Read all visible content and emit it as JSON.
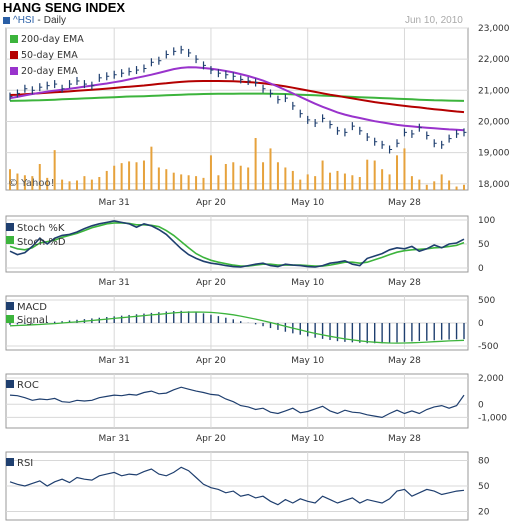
{
  "header": {
    "title": "HANG SENG INDEX",
    "symbol": "^HSI",
    "period": "Daily",
    "date": "Jun 10, 2010",
    "watermark": "© Yahoo!"
  },
  "colors": {
    "ema200": "#3cb43c",
    "ema50": "#b40000",
    "ema20": "#9933cc",
    "price": "#1f3f6f",
    "volume": "#e6a23c",
    "stochK": "#1f3f6f",
    "stochD": "#3cb43c",
    "macd": "#1f3f6f",
    "signal": "#3cb43c",
    "line": "#1f3f6f",
    "grid": "#d8d8d8"
  },
  "chart_data": [
    {
      "type": "line",
      "panel": "price",
      "ylim": [
        17800,
        23000
      ],
      "yticks": [
        "23,000",
        "22,000",
        "21,000",
        "20,000",
        "19,000",
        "18,000"
      ],
      "ytick_values": [
        23000,
        22000,
        21000,
        20000,
        19000,
        18000
      ],
      "xticks": [
        "Mar 31",
        "Apr 20",
        "May 10",
        "May 28"
      ],
      "xtick_index": [
        14,
        27,
        40,
        53
      ],
      "legend": [
        "200-day EMA",
        "50-day EMA",
        "20-day EMA"
      ],
      "price": [
        20800,
        20900,
        21050,
        21000,
        21100,
        21150,
        21200,
        21050,
        21200,
        21300,
        21200,
        21150,
        21400,
        21450,
        21500,
        21550,
        21600,
        21650,
        21700,
        21900,
        21950,
        22150,
        22250,
        22300,
        22200,
        22000,
        21800,
        21650,
        21550,
        21500,
        21450,
        21350,
        21300,
        21250,
        21050,
        20900,
        20700,
        20750,
        20500,
        20250,
        20050,
        19950,
        20100,
        19900,
        19700,
        19650,
        19850,
        19700,
        19500,
        19350,
        19250,
        19100,
        19300,
        19650,
        19600,
        19800,
        19550,
        19300,
        19250,
        19450,
        19600,
        19650
      ],
      "ema200": [
        20660,
        20665,
        20670,
        20675,
        20680,
        20690,
        20700,
        20710,
        20720,
        20730,
        20740,
        20750,
        20760,
        20770,
        20780,
        20790,
        20800,
        20805,
        20810,
        20820,
        20830,
        20840,
        20850,
        20860,
        20870,
        20875,
        20880,
        20885,
        20888,
        20890,
        20892,
        20893,
        20894,
        20894,
        20893,
        20890,
        20885,
        20880,
        20870,
        20860,
        20850,
        20840,
        20830,
        20820,
        20810,
        20800,
        20790,
        20780,
        20770,
        20760,
        20750,
        20740,
        20730,
        20720,
        20710,
        20700,
        20690,
        20680,
        20675,
        20670,
        20665,
        20660
      ],
      "ema50": [
        20850,
        20860,
        20875,
        20890,
        20905,
        20920,
        20935,
        20950,
        20965,
        20985,
        21000,
        21015,
        21035,
        21055,
        21075,
        21095,
        21115,
        21135,
        21155,
        21180,
        21205,
        21225,
        21250,
        21270,
        21285,
        21295,
        21300,
        21300,
        21298,
        21295,
        21290,
        21280,
        21265,
        21248,
        21225,
        21195,
        21160,
        21125,
        21085,
        21040,
        20995,
        20950,
        20905,
        20860,
        20820,
        20780,
        20740,
        20700,
        20660,
        20620,
        20590,
        20560,
        20530,
        20500,
        20475,
        20450,
        20420,
        20395,
        20370,
        20345,
        20320,
        20300
      ],
      "ema20": [
        20750,
        20790,
        20835,
        20880,
        20920,
        20960,
        20990,
        21020,
        21050,
        21085,
        21120,
        21150,
        21185,
        21220,
        21260,
        21300,
        21350,
        21400,
        21450,
        21500,
        21560,
        21620,
        21680,
        21720,
        21740,
        21735,
        21715,
        21690,
        21660,
        21620,
        21575,
        21520,
        21460,
        21390,
        21310,
        21220,
        21120,
        21010,
        20900,
        20790,
        20680,
        20570,
        20470,
        20380,
        20290,
        20220,
        20160,
        20110,
        20060,
        20010,
        19970,
        19930,
        19890,
        19860,
        19840,
        19820,
        19800,
        19780,
        19760,
        19745,
        19735,
        19720
      ]
    },
    {
      "type": "bar",
      "panel": "volume",
      "values": [
        120,
        95,
        85,
        80,
        150,
        70,
        230,
        60,
        50,
        55,
        80,
        60,
        75,
        110,
        140,
        155,
        165,
        160,
        170,
        250,
        130,
        120,
        100,
        90,
        85,
        80,
        70,
        200,
        85,
        150,
        160,
        140,
        130,
        300,
        160,
        240,
        160,
        130,
        110,
        60,
        90,
        80,
        170,
        100,
        110,
        95,
        85,
        75,
        175,
        170,
        120,
        90,
        200,
        240,
        80,
        60,
        30,
        50,
        90,
        55,
        20,
        30
      ]
    },
    {
      "type": "line",
      "panel": "stochastic",
      "ylim": [
        0,
        100
      ],
      "yticks": [
        "100",
        "50",
        "0"
      ],
      "ytick_values": [
        100,
        50,
        0
      ],
      "legend": [
        "Stoch %K",
        "Stoch %D"
      ],
      "k": [
        35,
        28,
        32,
        45,
        62,
        50,
        62,
        68,
        70,
        75,
        82,
        88,
        92,
        95,
        98,
        95,
        92,
        85,
        92,
        88,
        80,
        70,
        55,
        40,
        28,
        20,
        14,
        10,
        8,
        5,
        3,
        2,
        5,
        8,
        10,
        5,
        3,
        8,
        6,
        5,
        3,
        2,
        5,
        10,
        12,
        15,
        8,
        5,
        20,
        25,
        30,
        38,
        42,
        40,
        45,
        35,
        40,
        48,
        42,
        50,
        52,
        60
      ],
      "d": [
        45,
        40,
        38,
        42,
        52,
        55,
        58,
        64,
        68,
        72,
        78,
        84,
        88,
        92,
        94,
        94,
        93,
        90,
        90,
        89,
        86,
        78,
        68,
        55,
        42,
        30,
        22,
        16,
        12,
        9,
        6,
        4,
        4,
        6,
        8,
        8,
        6,
        6,
        6,
        6,
        5,
        4,
        4,
        6,
        9,
        12,
        12,
        10,
        12,
        17,
        22,
        28,
        33,
        36,
        38,
        39,
        40,
        42,
        43,
        45,
        47,
        53
      ]
    },
    {
      "type": "bar",
      "panel": "macd",
      "ylim": [
        -500,
        500
      ],
      "yticks": [
        "500",
        "0",
        "-500"
      ],
      "ytick_values": [
        500,
        0,
        -500
      ],
      "legend": [
        "MACD",
        "Signal"
      ],
      "macd": [
        -40,
        -30,
        -20,
        -10,
        5,
        20,
        30,
        40,
        55,
        70,
        85,
        100,
        115,
        130,
        145,
        160,
        175,
        190,
        205,
        220,
        235,
        250,
        260,
        265,
        255,
        235,
        210,
        180,
        150,
        115,
        80,
        40,
        5,
        -30,
        -70,
        -110,
        -150,
        -190,
        -225,
        -255,
        -290,
        -320,
        -345,
        -370,
        -395,
        -410,
        -420,
        -430,
        -440,
        -440,
        -440,
        -430,
        -420,
        -410,
        -400,
        -390,
        -385,
        -375,
        -365,
        -360,
        -355,
        -350
      ],
      "signal": [
        -60,
        -55,
        -48,
        -40,
        -32,
        -22,
        -12,
        0,
        12,
        25,
        40,
        55,
        70,
        85,
        100,
        115,
        130,
        145,
        160,
        175,
        190,
        205,
        220,
        230,
        237,
        240,
        238,
        230,
        218,
        200,
        178,
        150,
        118,
        85,
        48,
        10,
        -30,
        -70,
        -110,
        -150,
        -190,
        -225,
        -258,
        -290,
        -318,
        -345,
        -368,
        -388,
        -405,
        -418,
        -428,
        -434,
        -436,
        -435,
        -430,
        -423,
        -415,
        -406,
        -398,
        -390,
        -382,
        -375
      ]
    },
    {
      "type": "line",
      "panel": "roc",
      "ylim": [
        -1500,
        2000
      ],
      "yticks": [
        "2,000",
        "0",
        "-1,000"
      ],
      "ytick_values": [
        2000,
        0,
        -1000
      ],
      "legend": [
        "ROC"
      ],
      "values": [
        700,
        650,
        500,
        300,
        400,
        350,
        450,
        200,
        150,
        300,
        250,
        300,
        500,
        600,
        700,
        650,
        750,
        700,
        900,
        1000,
        800,
        850,
        1100,
        1300,
        1150,
        1000,
        900,
        750,
        700,
        400,
        200,
        -100,
        -200,
        -400,
        -300,
        -600,
        -700,
        -500,
        -300,
        -650,
        -550,
        -350,
        -150,
        -500,
        -700,
        -450,
        -600,
        -650,
        -800,
        -900,
        -1000,
        -700,
        -450,
        -700,
        -500,
        -700,
        -400,
        -200,
        -100,
        -300,
        -100,
        700
      ]
    },
    {
      "type": "line",
      "panel": "rsi",
      "ylim": [
        10,
        90
      ],
      "yticks": [
        "80",
        "50",
        "20"
      ],
      "ytick_values": [
        80,
        50,
        20
      ],
      "legend": [
        "RSI"
      ],
      "values": [
        55,
        52,
        50,
        53,
        56,
        50,
        55,
        58,
        54,
        60,
        58,
        57,
        62,
        64,
        66,
        62,
        64,
        63,
        67,
        70,
        64,
        62,
        66,
        72,
        68,
        60,
        52,
        48,
        46,
        42,
        44,
        38,
        40,
        36,
        38,
        32,
        28,
        34,
        30,
        35,
        32,
        30,
        38,
        34,
        30,
        33,
        36,
        30,
        34,
        32,
        30,
        35,
        44,
        46,
        38,
        42,
        46,
        44,
        40,
        42,
        44,
        45
      ]
    }
  ]
}
